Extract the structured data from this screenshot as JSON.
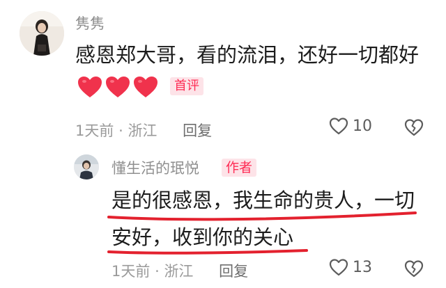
{
  "comment": {
    "username": "隽隽",
    "text": "感恩郑大哥，看的流泪，还好一切都好",
    "emoji": [
      "red-heart",
      "red-heart",
      "red-heart"
    ],
    "badge": "首评",
    "time": "1天前",
    "separator": "·",
    "location": "浙江",
    "reply_label": "回复",
    "likes": "10"
  },
  "reply": {
    "username": "懂生活的珉悦",
    "badge": "作者",
    "text": "是的很感恩，我生命的贵人，一切安好，收到你的关心",
    "time": "1天前",
    "separator": "·",
    "location": "浙江",
    "reply_label": "回复",
    "likes": "13"
  },
  "colors": {
    "accent": "#fe2c55",
    "badge_bg": "#fde3e8",
    "meta_text": "#9a9a9a",
    "heart": "#f0324c",
    "annotation": "#e3212e"
  },
  "icons": [
    "heart-outline-icon",
    "broken-heart-icon",
    "heart-emoji-icon"
  ],
  "annotation": "red-hand-drawn-underline"
}
